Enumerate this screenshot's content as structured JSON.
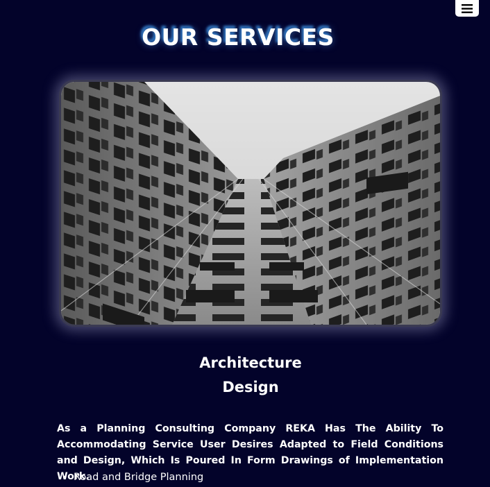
{
  "header": {
    "menu_icon": "hamburger-icon",
    "title": "OUR SERVICES"
  },
  "service": {
    "image_icon": "building-facade-photo",
    "title_line1": "Architecture",
    "title_line2": "Design",
    "description": "As a Planning Consulting Company REKA Has The Ability To Accommodating Service User Desires Adapted to Field Conditions and Design, Which Is Poured In Form Drawings of Implementation Work.",
    "items": [
      "Road and Bridge Planning"
    ]
  },
  "colors": {
    "background": "#03032a",
    "title_glow": "#2f6fb7",
    "image_frame": "#3a3a52"
  }
}
